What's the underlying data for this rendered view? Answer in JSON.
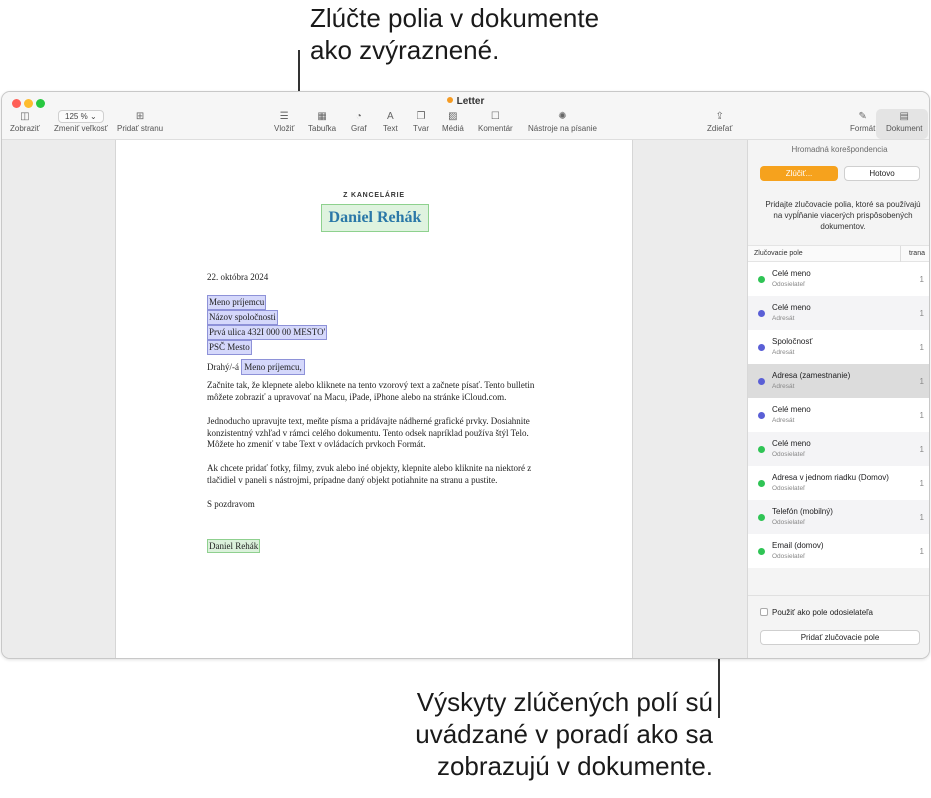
{
  "callouts": {
    "top_line1": "Zlúčte polia v dokumente",
    "top_line2": "ako zvýraznené.",
    "bottom_line1": "Výskyty zlúčených polí sú",
    "bottom_line2": "uvádzané v poradí ako sa",
    "bottom_line3": "zobrazujú v dokumente."
  },
  "window": {
    "title": "Letter"
  },
  "toolbar": {
    "view": "Zobraziť",
    "zoom_value": "125 %",
    "zoom": "Zmeniť veľkosť",
    "add_page": "Pridať stranu",
    "insert": "Vložiť",
    "table": "Tabuľka",
    "chart": "Graf",
    "text": "Text",
    "shape": "Tvar",
    "media": "Médiá",
    "comment": "Komentár",
    "writing_tools": "Nástroje na písanie",
    "share": "Zdieľať",
    "format": "Formát",
    "document": "Dokument"
  },
  "icons": {
    "view": "◫",
    "zoom": "⌄",
    "add_page": "⊞",
    "insert": "☰",
    "table": "▦",
    "chart": "◔",
    "text": "A",
    "shape": "❐",
    "media": "▨",
    "comment": "☐",
    "writing": "✺",
    "share": "⇪",
    "format": "✎",
    "document": "▤"
  },
  "letter": {
    "from_label": "Z KANCELÁRIE",
    "sender_name": "Daniel Rehák",
    "date": "22. októbra 2024",
    "recipient": "Meno príjemcu",
    "company": "Názov spoločnosti",
    "street": "Prvá ulica 432I 000 00 MESTO'",
    "postal": "PSČ  Mesto",
    "greeting_prefix": "Drahý/-á",
    "greeting_field": "Meno príjemcu,",
    "para1": "Začnite tak, že klepnete alebo kliknete na tento vzorový text a začnete písať. Tento bulletin môžete zobraziť a upravovať na Macu, iPade, iPhone alebo na stránke iCloud.com.",
    "para2": "Jednoducho upravujte text, meňte písma a pridávajte nádherné grafické prvky. Dosiahnite konzistentný vzhľad v rámci celého dokumentu. Tento odsek napríklad používa štýl Telo. Môžete ho zmeniť v tabe Text v ovládacích prvkoch Formát.",
    "para3": "Ak chcete pridať fotky, filmy, zvuk alebo iné objekty, klepnite alebo kliknite na niektoré z tlačidiel v paneli s nástrojmi, prípadne daný objekt potiahnite na stranu a pustite.",
    "closing": "S pozdravom",
    "signature": "Daniel Rehák"
  },
  "sidebar": {
    "header": "Hromadná korešpondencia",
    "merge_button": "Zlúčiť...",
    "done_button": "Hotovo",
    "description": "Pridajte zlučovacie polia, ktoré sa používajú na vypĺňanie viacerých prispôsobených dokumentov.",
    "col_field": "Zlučovacie pole",
    "col_page": "trana",
    "fields": [
      {
        "name": "Celé meno",
        "source": "Odosielateľ",
        "count": "1",
        "color": "#2fc455"
      },
      {
        "name": "Celé meno",
        "source": "Adresát",
        "count": "1",
        "color": "#5a5fd6"
      },
      {
        "name": "Spoločnosť",
        "source": "Adresát",
        "count": "1",
        "color": "#5a5fd6"
      },
      {
        "name": "Adresa (zamestnanie)",
        "source": "Adresát",
        "count": "1",
        "color": "#5a5fd6"
      },
      {
        "name": "Celé meno",
        "source": "Adresát",
        "count": "1",
        "color": "#5a5fd6"
      },
      {
        "name": "Celé meno",
        "source": "Odosielateľ",
        "count": "1",
        "color": "#2fc455"
      },
      {
        "name": "Adresa v jednom riadku (Domov)",
        "source": "Odosielateľ",
        "count": "1",
        "color": "#2fc455"
      },
      {
        "name": "Telefón (mobilný)",
        "source": "Odosielateľ",
        "count": "1",
        "color": "#2fc455"
      },
      {
        "name": "Email (domov)",
        "source": "Odosielateľ",
        "count": "1",
        "color": "#2fc455"
      }
    ],
    "use_as_sender": "Použiť ako pole odosielateľa",
    "add_field_button": "Pridať zlučovacie pole"
  }
}
